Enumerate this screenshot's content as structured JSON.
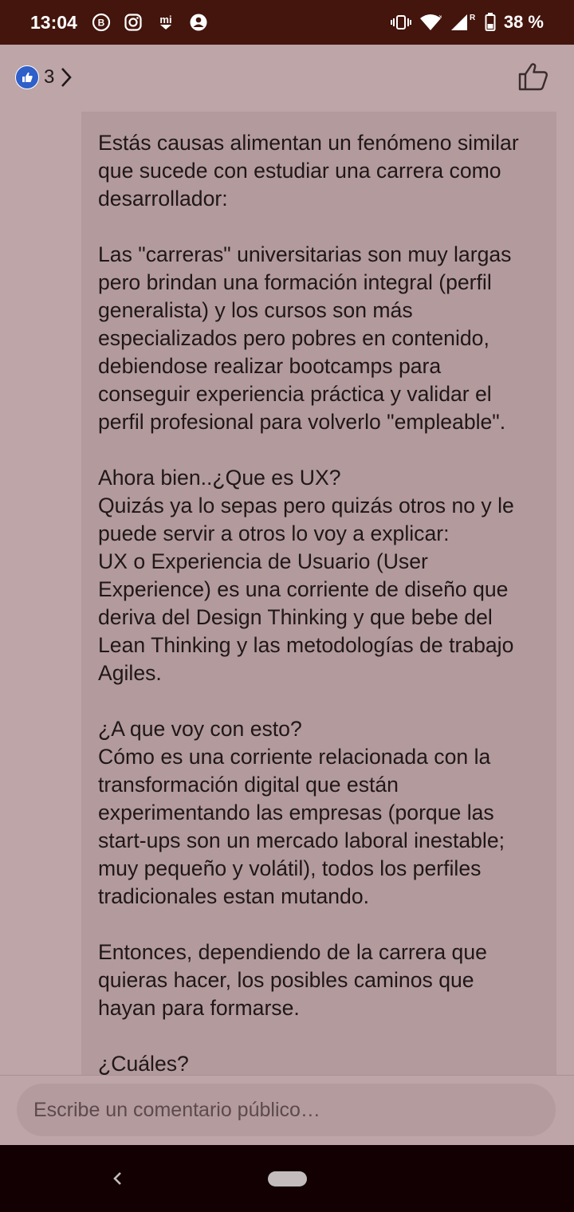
{
  "status_bar": {
    "time": "13:04",
    "battery": "38 %",
    "left_icons": [
      "b-circle-icon",
      "instagram-icon",
      "mi-icon",
      "messenger-icon"
    ],
    "right_icons": [
      "vibrate-icon",
      "wifi-icon",
      "signal-icon",
      "battery-icon"
    ],
    "signal_label": "R"
  },
  "header": {
    "reaction_count": "3"
  },
  "comment": {
    "paragraphs": [
      [
        "Estás causas alimentan un fenómeno similar",
        "que sucede con estudiar una carrera como",
        "desarrollador:"
      ],
      [
        "Las \"carreras\" universitarias son muy largas",
        "pero brindan una formación integral (perfil",
        "generalista) y los cursos son más",
        "especializados pero pobres en contenido,",
        "debiendose realizar bootcamps para",
        "conseguir experiencia práctica y validar el",
        "perfil profesional para volverlo \"empleable\"."
      ],
      [
        "Ahora bien..¿Que es UX?",
        "Quizás ya lo sepas pero quizás otros no y le",
        "puede servir a otros lo voy a explicar:",
        "UX o Experiencia de Usuario (User",
        "Experience) es una corriente de diseño que",
        "deriva del Design Thinking y que bebe del",
        "Lean Thinking y las metodologías de trabajo",
        "Agiles."
      ],
      [
        "¿A que voy con esto?",
        "Cómo es una corriente relacionada con la",
        "transformación digital que están",
        "experimentando las empresas (porque las",
        "start-ups son un mercado laboral inestable;",
        "muy pequeño y volátil), todos los perfiles",
        "tradicionales estan mutando."
      ],
      [
        "Entonces, dependiendo de la carrera que",
        "quieras hacer, los posibles caminos que",
        "hayan para formarse."
      ],
      [
        "¿Cuáles?"
      ]
    ]
  },
  "composer": {
    "placeholder": "Escribe un comentario público…"
  },
  "colors": {
    "status_bar": "#43150c",
    "background": "#bda5a8",
    "bubble": "#b39a9d",
    "like_blue": "#2f5fc9",
    "nav_bar": "#120002"
  }
}
